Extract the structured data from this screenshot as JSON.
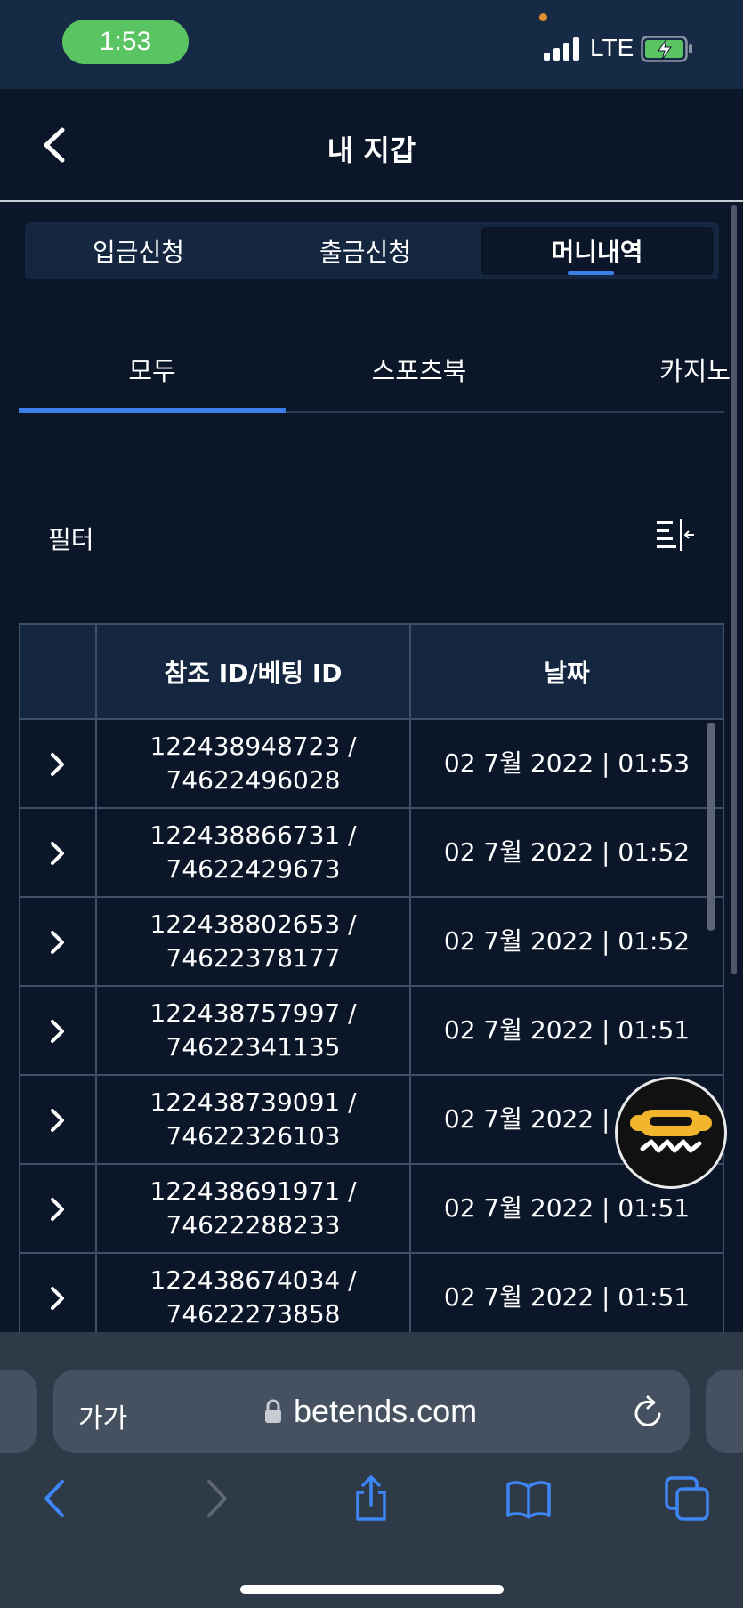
{
  "status_bar": {
    "time": "1:53",
    "network": "LTE"
  },
  "header": {
    "title": "내 지갑"
  },
  "page_tabs": [
    {
      "label": "입금신청",
      "active": false
    },
    {
      "label": "출금신청",
      "active": false
    },
    {
      "label": "머니내역",
      "active": true
    }
  ],
  "category_tabs": [
    {
      "label": "모두",
      "active": true
    },
    {
      "label": "스포츠북",
      "active": false
    },
    {
      "label": "카지노",
      "active": false
    }
  ],
  "filter": {
    "label": "필터"
  },
  "table": {
    "headers": [
      "",
      "참조 ID/베팅 ID",
      "날짜"
    ],
    "rows": [
      {
        "ref_id": "122438948723 /",
        "bet_id": "74622496028",
        "date": "02 7월 2022 | 01:53"
      },
      {
        "ref_id": "122438866731 /",
        "bet_id": "74622429673",
        "date": "02 7월 2022 | 01:52"
      },
      {
        "ref_id": "122438802653 /",
        "bet_id": "74622378177",
        "date": "02 7월 2022 | 01:52"
      },
      {
        "ref_id": "122438757997 /",
        "bet_id": "74622341135",
        "date": "02 7월 2022 | 01:51"
      },
      {
        "ref_id": "122438739091 /",
        "bet_id": "74622326103",
        "date": "02 7월 2022 | 01:51"
      },
      {
        "ref_id": "122438691971 /",
        "bet_id": "74622288233",
        "date": "02 7월 2022 | 01:51"
      },
      {
        "ref_id": "122438674034 /",
        "bet_id": "74622273858",
        "date": "02 7월 2022 | 01:51"
      }
    ]
  },
  "browser": {
    "text_size_label": "가가",
    "url": "betends.com"
  },
  "colors": {
    "background": "#0b1629",
    "accent": "#3b7fe8",
    "browser_accent": "#3d86f5",
    "time_pill": "#5ac463"
  },
  "icons": [
    "back-chevron-icon",
    "filter-icon",
    "chevron-right-icon",
    "chat-icon",
    "lock-icon",
    "reload-icon",
    "browser-back-icon",
    "browser-forward-icon",
    "share-icon",
    "bookmarks-icon",
    "tabs-icon"
  ]
}
